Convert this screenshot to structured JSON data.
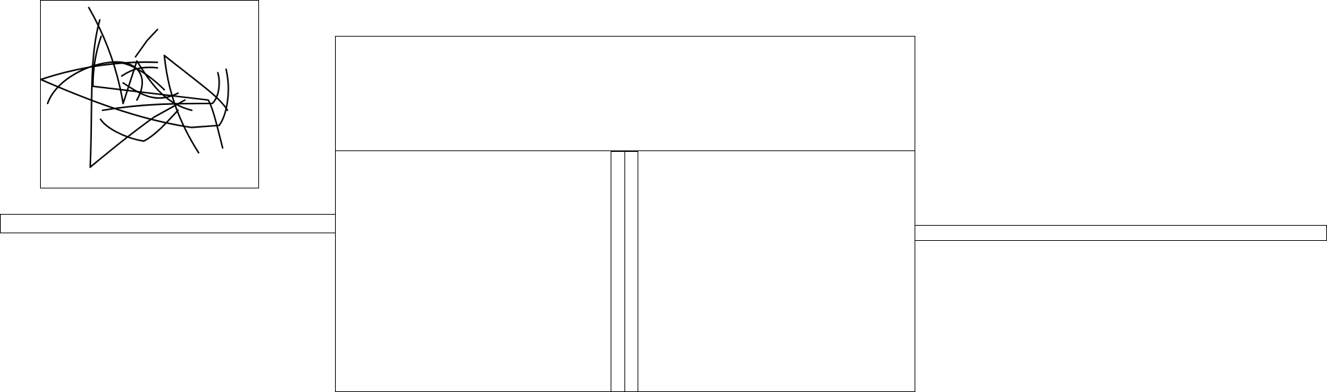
{
  "signature_pad": {
    "stroke_color": "#000000",
    "icon": "signature-scribble"
  },
  "left_input": {
    "value": ""
  },
  "right_input": {
    "value": ""
  },
  "panels": {
    "top": {
      "content": ""
    },
    "bottom_left": {
      "content": ""
    },
    "bottom_right": {
      "content": ""
    }
  }
}
